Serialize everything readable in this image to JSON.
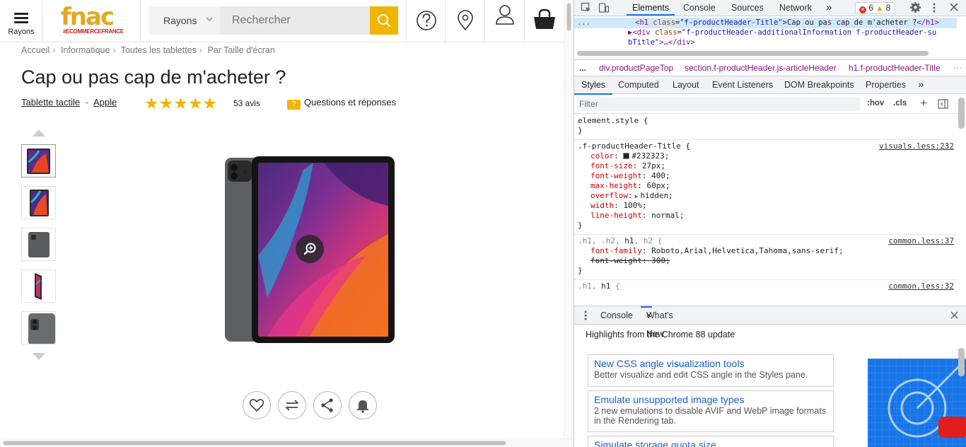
{
  "site": {
    "menu_label": "Rayons",
    "logo_text": "fnac",
    "logo_sub": "#ECOMMERCEFRANCE",
    "rayons_label": "Rayons",
    "search_placeholder": "Rechercher",
    "breadcrumb": [
      "Accueil",
      "Informatique",
      "Toutes les tablettes",
      "Par Taille d'écran"
    ],
    "breadcrumb_sep": "›",
    "title": "Cap ou pas cap de m'acheter ?",
    "category_link": "Tablette tactile",
    "brand_link": "Apple",
    "meta_sep": "-",
    "rating": 5,
    "stars": "★★★★★",
    "reviews": "53 avis",
    "qa_label": "Questions et réponses",
    "qa_icon_text": "?",
    "brand_color": "#f0b500",
    "thumb_count": 5
  },
  "devtools": {
    "tabs": [
      "Elements",
      "Console",
      "Sources",
      "Network"
    ],
    "more": "»",
    "errors": "6",
    "warnings": "8",
    "warn_icon": "▲",
    "dom_lines": {
      "ellipsis": "...",
      "h1_open": "<h1",
      "h1_class_attr": "class",
      "h1_class_val": "\"f-productHeader-Title\"",
      "h1_text": ">Cap ou pas cap de m'acheter ?",
      "h1_close": "</h1>",
      "div_open": "▶<div",
      "div_class_attr": "class",
      "div_class_val": "\"f-productHeader-additionalInformation f-productHeader-su",
      "div_cont": "bTitle\"",
      "div_rest": ">…</div>"
    },
    "breadcrumbs": [
      "...",
      "div.productPageTop",
      "section.f-productHeader.js-articleHeader",
      "h1.f-productHeader-Title"
    ],
    "styles_tabs": [
      "Styles",
      "Computed",
      "Layout",
      "Event Listeners",
      "DOM Breakpoints",
      "Properties",
      "»"
    ],
    "filter_placeholder": "Filter",
    "hov": ":hov",
    "cls": ".cls",
    "plus": "+",
    "rules": [
      {
        "selector": "element.style {",
        "close": "}",
        "source": ""
      },
      {
        "selector": ".f-productHeader-Title {",
        "source": "visuals.less:232",
        "close": "}",
        "props": [
          {
            "name": "color",
            "value": "#232323;"
          },
          {
            "name": "font-size",
            "value": "27px;"
          },
          {
            "name": "font-weight",
            "value": "400;"
          },
          {
            "name": "max-height",
            "value": "60px;"
          },
          {
            "name": "overflow",
            "value": "hidden;"
          },
          {
            "name": "width",
            "value": "100%;"
          },
          {
            "name": "line-height",
            "value": "normal;"
          }
        ]
      },
      {
        "selector_pre": ".h1, .h2, ",
        "selector_bold": "h1",
        "selector_post": ", h2 {",
        "source": "common.less:37",
        "close": "}",
        "props": [
          {
            "name": "font-family",
            "value": "Roboto,Arial,Helvetica,Tahoma,sans-serif;"
          },
          {
            "name": "font-weight",
            "value": "300;"
          }
        ]
      },
      {
        "selector_pre": ".h1, ",
        "selector_bold": "h1",
        "selector_post": " {",
        "source": "common.less:32"
      }
    ],
    "drawer_tabs": [
      "Console",
      "What's New"
    ],
    "drawer_close": "×",
    "highlights": "Highlights from the Chrome 88 update",
    "cards": [
      {
        "title": "New CSS angle visualization tools",
        "desc": "Better visualize and edit CSS angle in the Styles pane."
      },
      {
        "title": "Emulate unsupported image types",
        "desc": "2 new emulations to disable AVIF and WebP image formats in the Rendering tab."
      },
      {
        "title": "Simulate storage quota size",
        "desc": ""
      }
    ]
  }
}
